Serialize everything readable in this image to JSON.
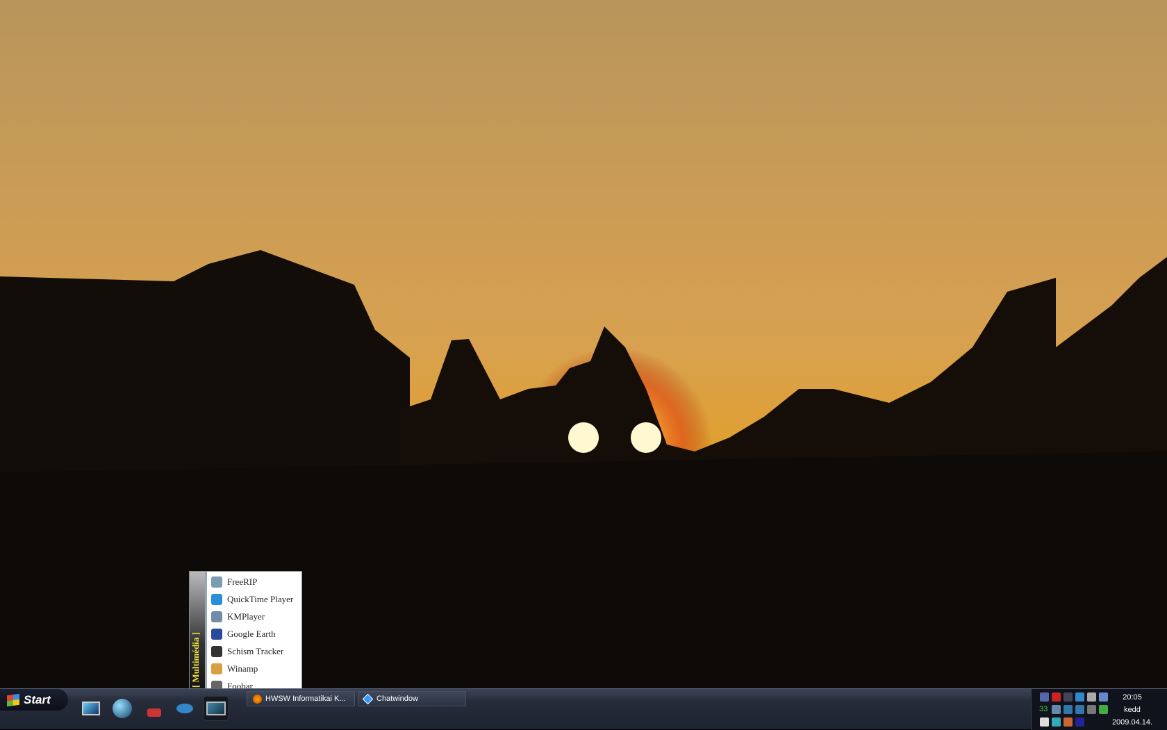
{
  "menu": {
    "title": "[ Multimédia ]",
    "items": [
      {
        "label": "FreeRIP",
        "icon": "freerip-icon",
        "color": "#7a9bb0"
      },
      {
        "label": "QuickTime Player",
        "icon": "quicktime-icon",
        "color": "#2a8fd8"
      },
      {
        "label": "KMPlayer",
        "icon": "kmplayer-icon",
        "color": "#6f8ca8"
      },
      {
        "label": "Google Earth",
        "icon": "google-earth-icon",
        "color": "#2a4a9a"
      },
      {
        "label": "Schism Tracker",
        "icon": "schism-tracker-icon",
        "color": "#333333"
      },
      {
        "label": "Winamp",
        "icon": "winamp-icon",
        "color": "#d8a040"
      },
      {
        "label": "Foobar",
        "icon": "foobar-icon",
        "color": "#666666"
      }
    ]
  },
  "taskbar": {
    "start_label": "Start",
    "quicklaunch": [
      {
        "icon": "monitor-icon"
      },
      {
        "icon": "globe-icon"
      },
      {
        "icon": "joystick-icon"
      },
      {
        "icon": "mouse-icon"
      },
      {
        "icon": "display-icon"
      }
    ],
    "tasks": [
      {
        "label": "HWSW Informatikai K...",
        "icon": "firefox-icon"
      },
      {
        "label": "Chatwindow",
        "icon": "chat-icon"
      }
    ]
  },
  "tray": {
    "time": "20:05",
    "day": "kedd",
    "date": "2009.04.14.",
    "counter": "33",
    "icons": [
      "app-icon",
      "ati-icon",
      "network-icon",
      "link-icon",
      "cd-icon",
      "power-icon",
      "network-computers-icon",
      "info-icon",
      "a-icon",
      "speaker-icon",
      "recycle-icon",
      "mouse-icon",
      "l-icon",
      "volume-icon",
      "shield-icon"
    ]
  }
}
